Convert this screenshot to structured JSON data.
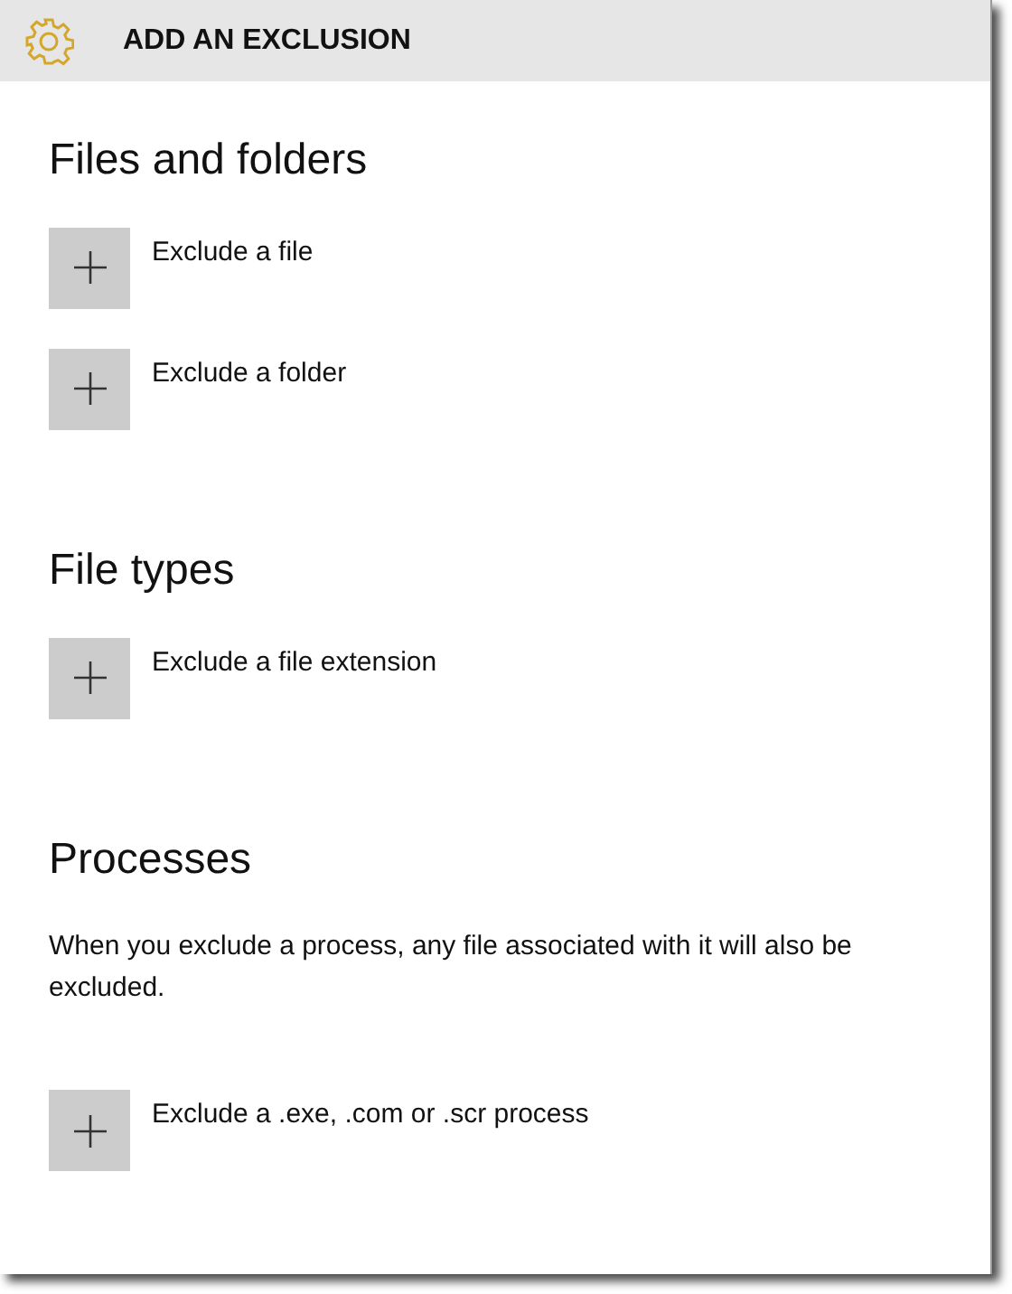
{
  "header": {
    "title": "ADD AN EXCLUSION"
  },
  "sections": [
    {
      "heading": "Files and folders",
      "actions": [
        {
          "label": "Exclude a file"
        },
        {
          "label": "Exclude a folder"
        }
      ]
    },
    {
      "heading": "File types",
      "actions": [
        {
          "label": "Exclude a file extension"
        }
      ]
    },
    {
      "heading": "Processes",
      "description": "When you exclude a process, any file associated with it will also be excluded.",
      "actions": [
        {
          "label": "Exclude a .exe, .com or .scr process"
        }
      ]
    }
  ]
}
